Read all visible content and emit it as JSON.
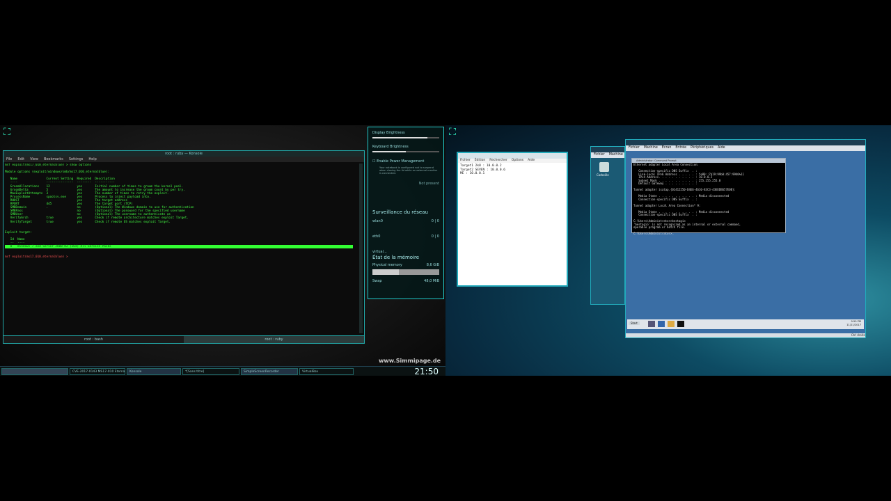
{
  "konsole": {
    "title": "root : ruby — Konsole",
    "menu": [
      "File",
      "Edit",
      "View",
      "Bookmarks",
      "Settings",
      "Help"
    ],
    "tabs": [
      "root : bash",
      "root : ruby"
    ],
    "lines": [
      "msf exploit(ms17_010_eternalblue) > show options",
      "",
      "Module options (exploit/windows/smb/ms17_010_eternalblue):",
      "",
      "   Name                Current Setting  Required  Description",
      "   ----                ---------------  --------  -----------",
      "   GroomAllocations    12               yes       Initial number of times to groom the kernel pool.",
      "   GroomDelta          5                yes       The amount to increase the groom count by per try.",
      "   MaxExploitAttempts  3                yes       The number of times to retry the exploit.",
      "   ProcessName         spoolsv.exe      yes       Process to inject payload into.",
      "   RHOST                                yes       The target address",
      "   RPORT               445              yes       The target port (TCP)",
      "   SMBDomain           .                no        (Optional) The Windows domain to use for authentication",
      "   SMBPass                              no        (Optional) The password for the specified username",
      "   SMBUser                              no        (Optional) The username to authenticate as",
      "   VerifyArch          true             yes       Check if remote architecture matches exploit Target.",
      "   VerifyTarget        true             yes       Check if remote OS matches exploit Target.",
      "",
      "",
      "Exploit target:",
      "",
      "   Id  Name",
      "   --  ----"
    ],
    "highlight_line": "   0   Windows 7 and Server 2008 R2 (x64) All Service Packs",
    "prompt": "msf exploit(ms17_010_eternalblue) > "
  },
  "applet": {
    "display_brightness": "Display Brightness",
    "display_level": 0.82,
    "keyboard_brightness": "Keyboard Brightness",
    "keyboard_level": 0.5,
    "power_mgmt": "Enable Power Management",
    "power_note": "Your notebook is configured not to suspend when closing the lid while an external monitor is connected.",
    "battery": "Not present"
  },
  "network": {
    "title": "Surveillance du réseau",
    "rows": [
      {
        "name": "wlan0",
        "val": "0 | 0"
      },
      {
        "name": "eth0",
        "val": "0 | 0"
      },
      {
        "name": "virtual...",
        "val": ""
      }
    ]
  },
  "memory": {
    "title": "État de la mémoire",
    "physical_label": "Physical memory",
    "physical_val": "8,6 GiB",
    "physical_level": 0.4,
    "swap_label": "Swap",
    "swap_val": "48,0 MiB"
  },
  "taskbar": {
    "tasks": [
      "CVE-2017-0143 MS17-010 Eternal...",
      "Konsole",
      "*[Sans titre]",
      "SimpleScreenRecorder",
      "VirtualBox"
    ],
    "clock": "21:50"
  },
  "watermark": "www.Simmipage.de",
  "notepad": {
    "menu": [
      "Fichier",
      "Édition",
      "Rechercher",
      "Options",
      "Aide"
    ],
    "lines": [
      "Target1 2k8 : 10.0.0.2",
      "Target2 SEVEN : 10.0.0.6",
      "ME : 10.0.0.1"
    ]
  },
  "vbox_small": {
    "menu": [
      "Fichier",
      "Machine"
    ],
    "icon_label": "Corbeille"
  },
  "vbox_main": {
    "menu": [
      "Fichier",
      "Machine",
      "Écran",
      "Entrée",
      "Périphériques",
      "Aide"
    ],
    "cmd_title": "Administrator: Command Prompt",
    "cmd_lines": [
      "Ethernet adapter Local Area Connection:",
      "",
      "   Connection-specific DNS Suffix  . :",
      "   Link-local IPv6 Address . . . . . : fe80::7b19:99b0:457:9940%11",
      "   IPv4 Address. . . . . . . . . . . : 10.0.0.2",
      "   Subnet Mask . . . . . . . . . . . : 255.255.255.0",
      "   Default Gateway . . . . . . . . . :",
      "",
      "Tunnel adapter isatap.{01412250-D4E6-4610-83C3-43EEDB657E0B}:",
      "",
      "   Media State . . . . . . . . . . . : Media disconnected",
      "   Connection-specific DNS Suffix  . :",
      "",
      "Tunnel adapter Local Area Connection* 9:",
      "",
      "   Media State . . . . . . . . . . . : Media disconnected",
      "   Connection-specific DNS Suffix  . :",
      "",
      "C:\\Users\\Administrator>bestagio",
      "'bestagio' is not recognized as an internal or external command,",
      "operable program or batch file.",
      "",
      "C:\\Users\\Administrator>_"
    ],
    "start": "Start",
    "time": "9:50 PM",
    "date": "11/21/2017",
    "hostkey": "Ctrl droite"
  }
}
